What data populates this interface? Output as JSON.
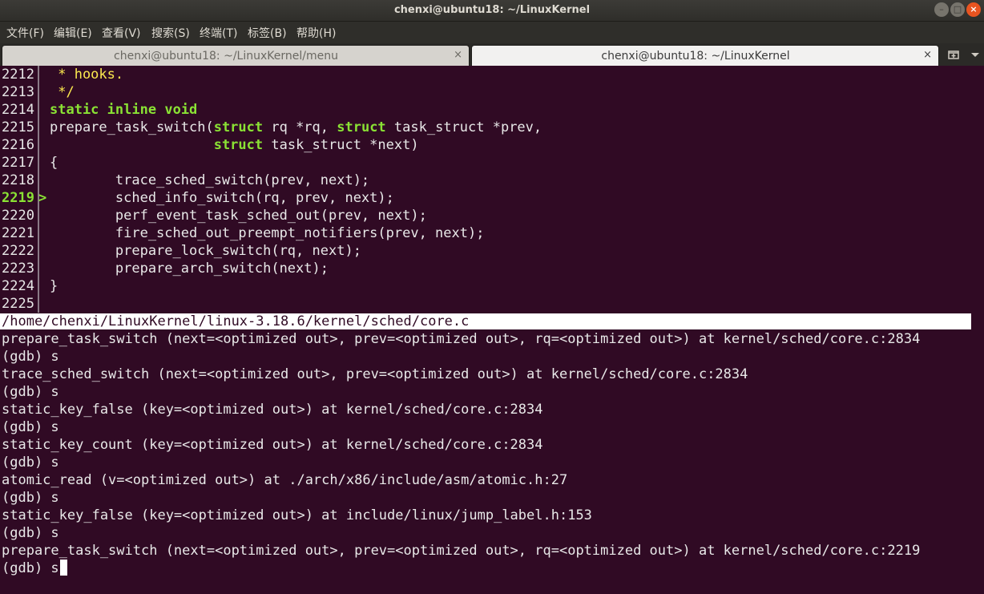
{
  "window": {
    "title": "chenxi@ubuntu18: ~/LinuxKernel",
    "buttons": {
      "minimize": "–",
      "maximize": "□",
      "close": "×"
    }
  },
  "menu": [
    "文件(F)",
    "编辑(E)",
    "查看(V)",
    "搜索(S)",
    "终端(T)",
    "标签(B)",
    "帮助(H)"
  ],
  "tabs": [
    {
      "label": "chenxi@ubuntu18: ~/LinuxKernel/menu",
      "close": "×",
      "active": false
    },
    {
      "label": "chenxi@ubuntu18: ~/LinuxKernel",
      "close": "×",
      "active": true
    }
  ],
  "tab_actions": {
    "new_tab_icon": "new-tab-icon",
    "menu_icon": "tab-menu-icon"
  },
  "source": {
    "current_line": "2219",
    "arrow": ">",
    "lines": [
      {
        "num": "2212",
        "text": " * hooks."
      },
      {
        "num": "2213",
        "text": " */"
      },
      {
        "num": "2214",
        "text": "static inline void"
      },
      {
        "num": "2215",
        "text": "prepare_task_switch(struct rq *rq, struct task_struct *prev,"
      },
      {
        "num": "2216",
        "text": "                    struct task_struct *next)"
      },
      {
        "num": "2217",
        "text": "{"
      },
      {
        "num": "2218",
        "text": "        trace_sched_switch(prev, next);"
      },
      {
        "num": "2219",
        "text": "        sched_info_switch(rq, prev, next);"
      },
      {
        "num": "2220",
        "text": "        perf_event_task_sched_out(prev, next);"
      },
      {
        "num": "2221",
        "text": "        fire_sched_out_preempt_notifiers(prev, next);"
      },
      {
        "num": "2222",
        "text": "        prepare_lock_switch(rq, next);"
      },
      {
        "num": "2223",
        "text": "        prepare_arch_switch(next);"
      },
      {
        "num": "2224",
        "text": "}"
      },
      {
        "num": "2225",
        "text": ""
      }
    ],
    "file_path": "/home/chenxi/LinuxKernel/linux-3.18.6/kernel/sched/core.c"
  },
  "gdb": {
    "lines": [
      "prepare_task_switch (next=<optimized out>, prev=<optimized out>, rq=<optimized out>) at kernel/sched/core.c:2834",
      "(gdb) s",
      "trace_sched_switch (next=<optimized out>, prev=<optimized out>) at kernel/sched/core.c:2834",
      "(gdb) s",
      "static_key_false (key=<optimized out>) at kernel/sched/core.c:2834",
      "(gdb) s",
      "static_key_count (key=<optimized out>) at kernel/sched/core.c:2834",
      "(gdb) s",
      "atomic_read (v=<optimized out>) at ./arch/x86/include/asm/atomic.h:27",
      "(gdb) s",
      "static_key_false (key=<optimized out>) at include/linux/jump_label.h:153",
      "(gdb) s",
      "prepare_task_switch (next=<optimized out>, prev=<optimized out>, rq=<optimized out>) at kernel/sched/core.c:2219"
    ],
    "prompt": "(gdb) s"
  },
  "colors": {
    "background": "#300a24",
    "keyword": "#8ae234",
    "comment": "#fce94f",
    "text": "#e8e8e8",
    "accent": "#e95420"
  }
}
